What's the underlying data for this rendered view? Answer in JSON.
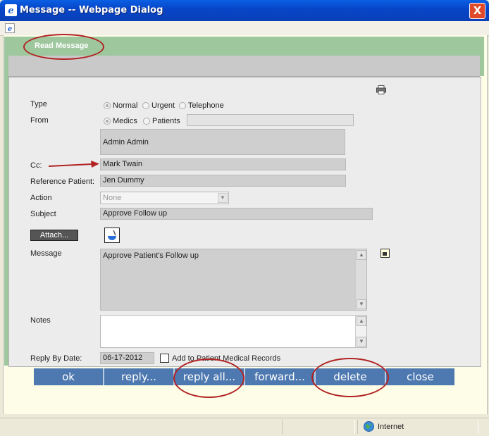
{
  "window": {
    "title": "Message -- Webpage Dialog",
    "close_label": "X"
  },
  "header": {
    "section_title": "Read Message"
  },
  "form": {
    "type_label": "Type",
    "type_options": [
      "Normal",
      "Urgent",
      "Telephone"
    ],
    "from_label": "From",
    "from_options": [
      "Medics",
      "Patients"
    ],
    "from_value": "Admin Admin",
    "cc_label": "Cc:",
    "cc_value": "Mark Twain",
    "ref_label": "Reference Patient:",
    "ref_value": "Jen Dummy",
    "action_label": "Action",
    "action_value": "None",
    "subject_label": "Subject",
    "subject_value": "Approve Follow up",
    "attach_label": "Attach...",
    "message_label": "Message",
    "message_value": "Approve Patient's Follow up",
    "notes_label": "Notes",
    "reply_by_label": "Reply By Date:",
    "reply_by_value": "06-17-2012",
    "add_records_label": "Add to Patient Medical Records"
  },
  "buttons": {
    "ok": "ok",
    "reply": "reply...",
    "reply_all": "reply all...",
    "forward": "forward...",
    "delete": "delete",
    "close": "close"
  },
  "status": {
    "zone": "Internet"
  },
  "colors": {
    "accent_blue": "#4e79b0",
    "green_bar": "#9ec79e",
    "annotation_red": "#b22222"
  }
}
